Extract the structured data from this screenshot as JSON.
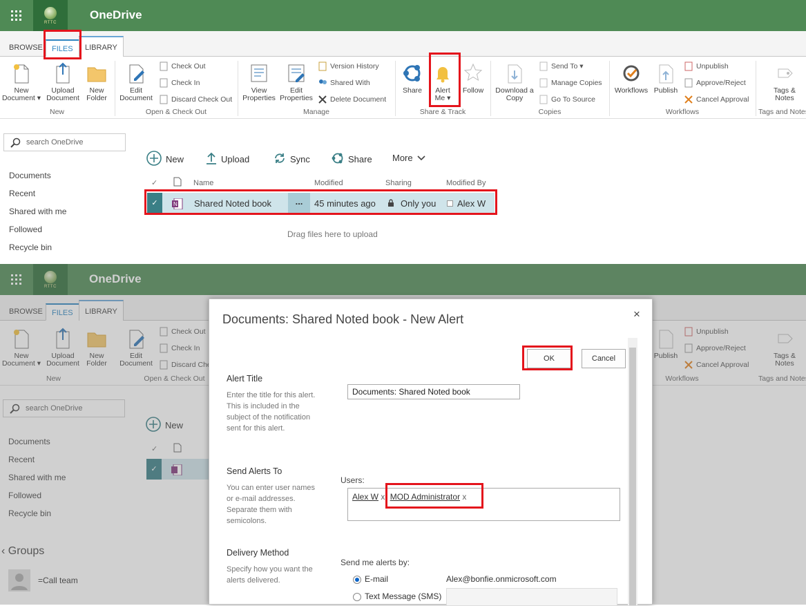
{
  "app": {
    "name": "OneDrive",
    "logo_text": "RTTC"
  },
  "tabs": [
    "BROWSE",
    "FILES",
    "LIBRARY"
  ],
  "ribbon": {
    "new_doc": "New Document",
    "upload_doc": "Upload Document",
    "new_folder": "New Folder",
    "grp_new": "New",
    "edit_doc": "Edit Document",
    "check_out": "Check Out",
    "check_in": "Check In",
    "discard": "Discard Check Out",
    "grp_open": "Open & Check Out",
    "view_props": "View Properties",
    "edit_props": "Edit Properties",
    "version_history": "Version History",
    "shared_with": "Shared With",
    "delete_doc": "Delete Document",
    "grp_manage": "Manage",
    "share": "Share",
    "alert_me": "Alert Me",
    "follow": "Follow",
    "grp_share": "Share & Track",
    "download_copy": "Download a Copy",
    "send_to": "Send To",
    "manage_copies": "Manage Copies",
    "go_to_source": "Go To Source",
    "grp_copies": "Copies",
    "workflows": "Workflows",
    "publish": "Publish",
    "unpublish": "Unpublish",
    "approve": "Approve/Reject",
    "cancel_approval": "Cancel Approval",
    "grp_workflows": "Workflows",
    "tags_notes": "Tags & Notes",
    "grp_tags": "Tags and Notes"
  },
  "sidebar": {
    "search_placeholder": "search OneDrive",
    "items": [
      "Documents",
      "Recent",
      "Shared with me",
      "Followed",
      "Recycle bin"
    ],
    "groups_title": "Groups",
    "group_item": "=Call team"
  },
  "commands": {
    "new": "New",
    "upload": "Upload",
    "sync": "Sync",
    "share": "Share",
    "more": "More"
  },
  "table": {
    "headers": {
      "name": "Name",
      "modified": "Modified",
      "sharing": "Sharing",
      "modified_by": "Modified By"
    },
    "row": {
      "name": "Shared Noted book",
      "ellipsis": "...",
      "modified": "45 minutes ago",
      "sharing": "Only you",
      "modified_by": "Alex W"
    },
    "drop_hint": "Drag files here to upload"
  },
  "dialog": {
    "title": "Documents: Shared Noted book - New Alert",
    "close": "×",
    "ok": "OK",
    "cancel": "Cancel",
    "alert_title_label": "Alert Title",
    "alert_title_desc": "Enter the title for this alert. This is included in the subject of the notification sent for this alert.",
    "alert_title_value": "Documents: Shared Noted book",
    "send_to_label": "Send Alerts To",
    "send_to_desc": "You can enter user names or e-mail addresses. Separate them with semicolons.",
    "users_label": "Users:",
    "user1": "Alex W",
    "user2": "MOD Administrator",
    "remove": "x",
    "delivery_label": "Delivery Method",
    "delivery_desc": "Specify how you want the alerts delivered.",
    "send_by_label": "Send me alerts by:",
    "email_option": "E-mail",
    "email_value": "Alex@bonfie.onmicrosoft.com",
    "sms_option": "Text Message (SMS)"
  },
  "colors": {
    "brand": "#4f8a55",
    "accent": "#0a64c8",
    "highlight": "#e4141c",
    "selected_row": "#cfe4ea"
  }
}
